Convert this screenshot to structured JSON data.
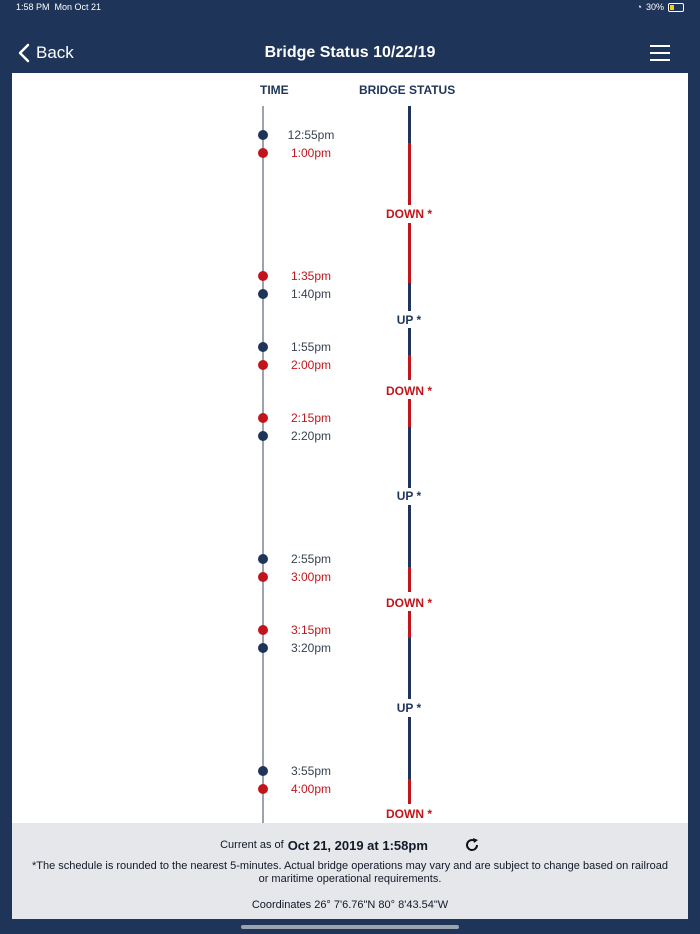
{
  "status_bar": {
    "time": "1:58 PM",
    "date": "Mon Oct 21",
    "battery": "30%"
  },
  "nav": {
    "back_label": "Back",
    "title": "Bridge Status 10/22/19"
  },
  "columns": {
    "time": "TIME",
    "status": "BRIDGE STATUS"
  },
  "colors": {
    "navy": "#1f3459",
    "red": "#c0161b"
  },
  "events": [
    {
      "time": "12:55pm",
      "state": "up"
    },
    {
      "time": "1:00pm",
      "state": "down"
    },
    {
      "time": "1:35pm",
      "state": "down"
    },
    {
      "time": "1:40pm",
      "state": "up"
    },
    {
      "time": "1:55pm",
      "state": "up"
    },
    {
      "time": "2:00pm",
      "state": "down"
    },
    {
      "time": "2:15pm",
      "state": "down"
    },
    {
      "time": "2:20pm",
      "state": "up"
    },
    {
      "time": "2:55pm",
      "state": "up"
    },
    {
      "time": "3:00pm",
      "state": "down"
    },
    {
      "time": "3:15pm",
      "state": "down"
    },
    {
      "time": "3:20pm",
      "state": "up"
    },
    {
      "time": "3:55pm",
      "state": "up"
    },
    {
      "time": "4:00pm",
      "state": "down"
    }
  ],
  "status_labels": [
    "DOWN *",
    "UP *",
    "DOWN *",
    "UP *",
    "DOWN *",
    "UP *",
    "DOWN *"
  ],
  "footer": {
    "current_prefix": "Current as of",
    "current_value": "Oct 21, 2019 at 1:58pm",
    "disclaimer": "*The schedule is rounded to the nearest 5-minutes. Actual bridge operations may vary and are subject to change based on railroad or maritime operational requirements.",
    "coordinates": "Coordinates 26° 7'6.76\"N 80° 8'43.54\"W"
  }
}
